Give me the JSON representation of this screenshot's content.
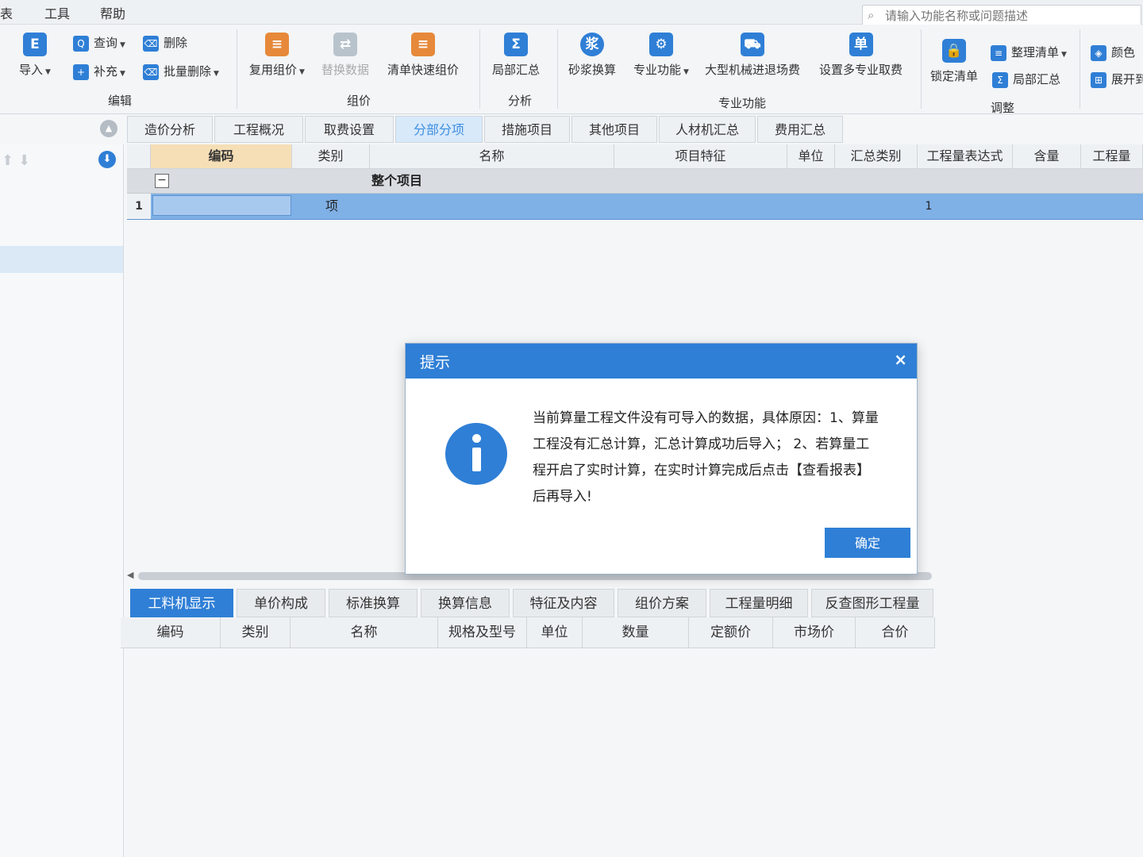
{
  "menu": {
    "items": [
      "表",
      "工具",
      "帮助"
    ]
  },
  "search": {
    "placeholder": "请输入功能名称或问题描述"
  },
  "ribbon": {
    "edit": {
      "label": "编辑",
      "import": "导入",
      "query": "查询",
      "supplement": "补充",
      "delete": "删除",
      "batch_delete": "批量删除"
    },
    "pricing": {
      "label": "组价",
      "reuse": "复用组价",
      "replace_data": "替换数据",
      "quick_pricing": "清单快速组价"
    },
    "analysis": {
      "label": "分析",
      "partial_summary": "局部汇总"
    },
    "special": {
      "label": "专业功能",
      "mortar": "砂浆换算",
      "professional": "专业功能",
      "machinery": "大型机械进退场费",
      "multi_fee": "设置多专业取费"
    },
    "adjust": {
      "label": "调整",
      "lock": "锁定清单",
      "organize": "整理清单",
      "partial_summary": "局部汇总",
      "color": "颜色",
      "expand": "展开到"
    }
  },
  "tabs": [
    "造价分析",
    "工程概况",
    "取费设置",
    "分部分项",
    "措施项目",
    "其他项目",
    "人材机汇总",
    "费用汇总"
  ],
  "grid": {
    "headers": [
      "编码",
      "类别",
      "名称",
      "项目特征",
      "单位",
      "汇总类别",
      "工程量表达式",
      "含量",
      "工程量"
    ],
    "group_name": "整个项目",
    "row": {
      "num": "1",
      "category": "项",
      "quantity": "1"
    }
  },
  "bottom_tabs": [
    "工料机显示",
    "单价构成",
    "标准换算",
    "换算信息",
    "特征及内容",
    "组价方案",
    "工程量明细",
    "反查图形工程量"
  ],
  "bottom_headers": [
    "编码",
    "类别",
    "名称",
    "规格及型号",
    "单位",
    "数量",
    "定额价",
    "市场价",
    "合价"
  ],
  "dialog": {
    "title": "提示",
    "message": "当前算量工程文件没有可导入的数据，具体原因：1、算量工程没有汇总计算，汇总计算成功后导入；  2、若算量工程开启了实时计算，在实时计算完成后点击【查看报表】后再导入!",
    "ok": "确定",
    "close": "×"
  }
}
